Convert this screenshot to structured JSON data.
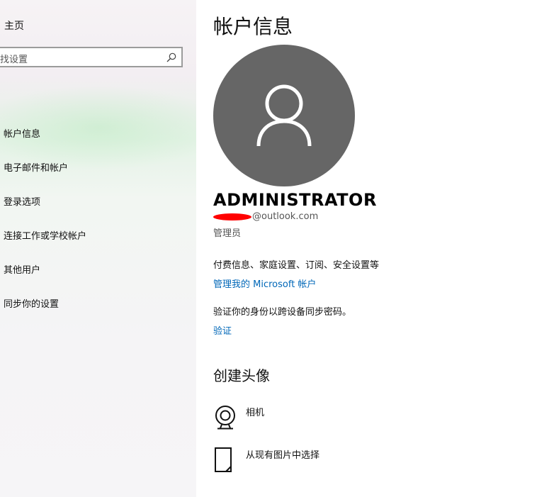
{
  "sidebar": {
    "home_label": "主页",
    "search_placeholder": "找设置",
    "items": [
      {
        "label": "帐户信息"
      },
      {
        "label": "电子邮件和帐户"
      },
      {
        "label": "登录选项"
      },
      {
        "label": "连接工作或学校帐户"
      },
      {
        "label": "其他用户"
      },
      {
        "label": "同步你的设置"
      }
    ]
  },
  "main": {
    "title": "帐户信息",
    "username": "ADMINISTRATOR",
    "email_visible": "@outlook.com",
    "role": "管理员",
    "billing_text": "付费信息、家庭设置、订阅、安全设置等",
    "manage_link": "管理我的 Microsoft 帐户",
    "verify_text": "验证你的身份以跨设备同步密码。",
    "verify_link": "验证",
    "create_avatar_heading": "创建头像",
    "options": [
      {
        "label": "相机",
        "icon": "camera-icon"
      },
      {
        "label": "从现有图片中选择",
        "icon": "image-file-icon"
      }
    ]
  },
  "colors": {
    "accent_link": "#0067b8",
    "avatar_bg": "#666666"
  }
}
